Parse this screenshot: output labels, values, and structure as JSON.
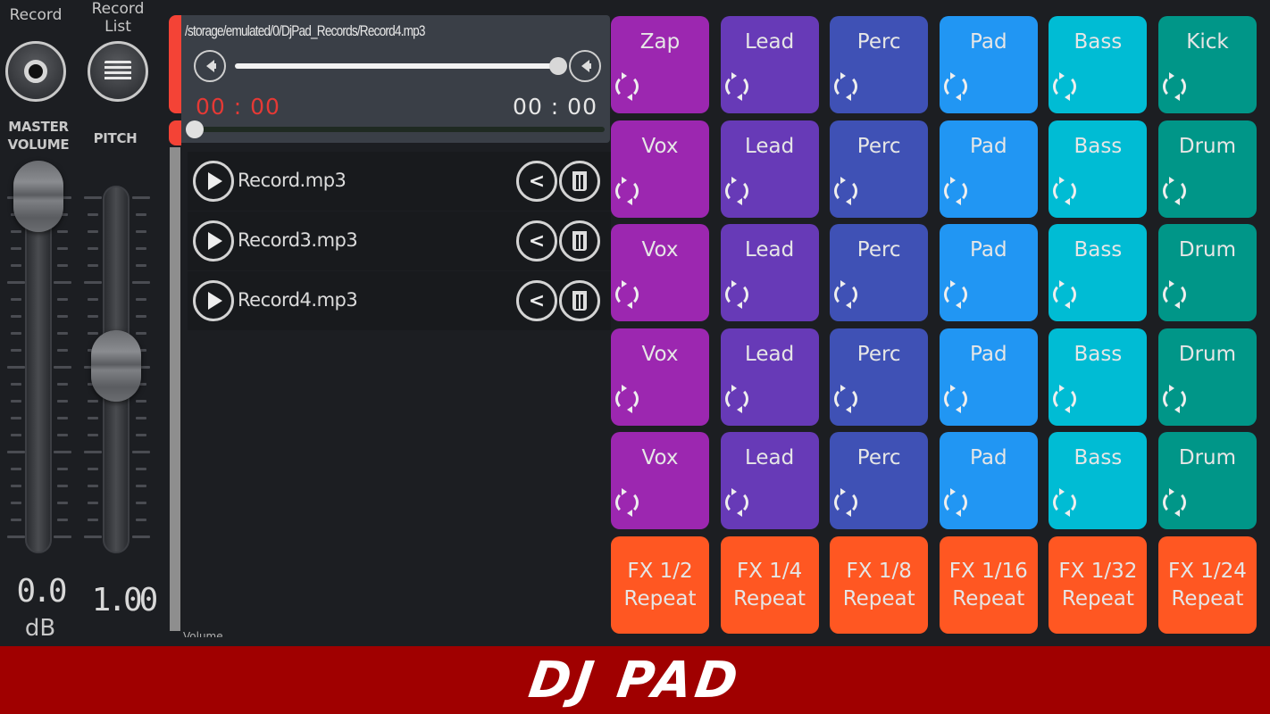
{
  "mixer": {
    "record_label": "Record",
    "record_list_label": "Record\nList",
    "master_volume_label": "MASTER\nVOLUME",
    "pitch_label": "PITCH",
    "master_volume_value": "0.0",
    "master_volume_unit": "dB",
    "pitch_value": "1.00",
    "master_volume_level": 1.0,
    "pitch_level": 0.5
  },
  "player": {
    "file_path": "/storage/emulated/0/DjPad_Records/Record4.mp3",
    "volume_level": 1.0,
    "current_time": "00 : 00",
    "total_time": "00 : 00",
    "seek_progress": 0,
    "colors": {
      "current_time": "#e53935",
      "accent": "#f44336"
    }
  },
  "records": [
    {
      "name": "Record.mp3"
    },
    {
      "name": "Record3.mp3"
    },
    {
      "name": "Record4.mp3"
    }
  ],
  "cut_label": "Volume",
  "pads": {
    "column_colors": [
      "#9c27b0",
      "#673ab7",
      "#3f51b5",
      "#2196f3",
      "#00bcd4",
      "#009688"
    ],
    "rows": [
      [
        "Zap",
        "Lead",
        "Perc",
        "Pad",
        "Bass",
        "Kick"
      ],
      [
        "Vox",
        "Lead",
        "Perc",
        "Pad",
        "Bass",
        "Drum"
      ],
      [
        "Vox",
        "Lead",
        "Perc",
        "Pad",
        "Bass",
        "Drum"
      ],
      [
        "Vox",
        "Lead",
        "Perc",
        "Pad",
        "Bass",
        "Drum"
      ],
      [
        "Vox",
        "Lead",
        "Perc",
        "Pad",
        "Bass",
        "Drum"
      ]
    ],
    "loop_icon": "loop-icon",
    "fx_color": "#ff5722",
    "fx": [
      {
        "line1": "FX 1/2",
        "line2": "Repeat"
      },
      {
        "line1": "FX 1/4",
        "line2": "Repeat"
      },
      {
        "line1": "FX 1/8",
        "line2": "Repeat"
      },
      {
        "line1": "FX 1/16",
        "line2": "Repeat"
      },
      {
        "line1": "FX 1/32",
        "line2": "Repeat"
      },
      {
        "line1": "FX 1/24",
        "line2": "Repeat"
      }
    ]
  },
  "footer": {
    "logo": "DJ PAD",
    "color": "#a00000"
  }
}
